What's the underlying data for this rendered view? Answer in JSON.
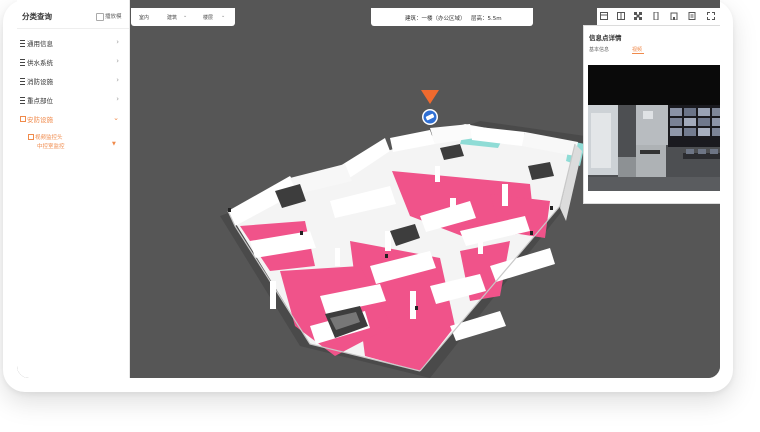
{
  "sidebar": {
    "title": "分类查询",
    "mode_label": "播放模",
    "items": [
      {
        "label": "通用信息"
      },
      {
        "label": "供水系统"
      },
      {
        "label": "消防设施"
      },
      {
        "label": "重点部位"
      },
      {
        "label": "安防设施"
      }
    ],
    "sub_item": "视频监控头",
    "sub_sub_item": "中控室监控"
  },
  "toolbar": {
    "floor": "室内",
    "building": "建筑",
    "floor_select": "楼层"
  },
  "infobar": {
    "building": "建筑：一楼（办公区域）",
    "height": "层高：5.5m"
  },
  "panel": {
    "title": "信息点详情",
    "tab_basic": "基本信息",
    "tab_video": "视频"
  },
  "colors": {
    "accent": "#f08a4b",
    "floor_pink": "#f0538a",
    "wall": "#f3f3f3",
    "marker": "#f06a2e",
    "marker_badge": "#2f6fd4"
  }
}
